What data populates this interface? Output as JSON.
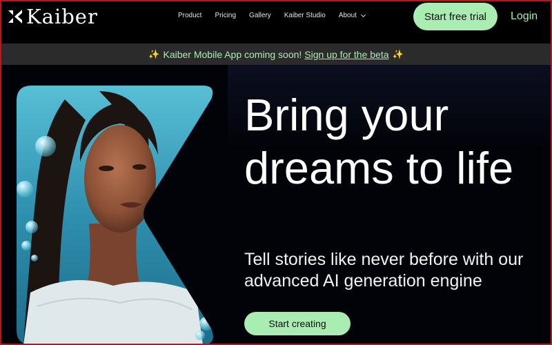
{
  "header": {
    "logo_text": "Kaiber",
    "nav": [
      {
        "label": "Product"
      },
      {
        "label": "Pricing"
      },
      {
        "label": "Gallery"
      },
      {
        "label": "Kaiber Studio"
      },
      {
        "label": "About"
      }
    ],
    "cta_label": "Start free trial",
    "login_label": "Login"
  },
  "banner": {
    "sparkle": "✨",
    "text": "Kaiber Mobile App coming soon!",
    "link": "Sign up for the beta"
  },
  "hero": {
    "headline": "Bring your dreams to life",
    "subhead": "Tell stories like never before with our advanced AI generation engine",
    "cta_label": "Start creating"
  },
  "colors": {
    "accent": "#a9edb3",
    "background": "#000000",
    "banner_bg": "#2b2b2b",
    "sparkle": "#f4c542"
  },
  "icons": [
    "kaiber-logo-icon",
    "chevron-down-icon",
    "sparkle-icon"
  ]
}
